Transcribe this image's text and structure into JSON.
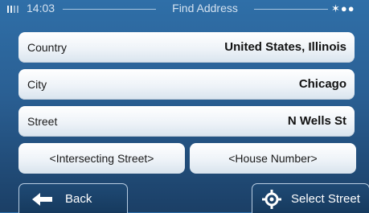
{
  "status_bar": {
    "time": "14:03",
    "title": "Find Address",
    "battery_icon": "battery-bars-icon",
    "satellite_icon": "satellite-dots-icon"
  },
  "rows": [
    {
      "label": "Country",
      "value": "United States, Illinois"
    },
    {
      "label": "City",
      "value": "Chicago"
    },
    {
      "label": "Street",
      "value": "N Wells St"
    }
  ],
  "split_buttons": {
    "intersecting_street": "<Intersecting Street>",
    "house_number": "<House Number>"
  },
  "bottom_bar": {
    "back_label": "Back",
    "back_icon": "arrow-left-icon",
    "select_label": "Select Street",
    "select_icon": "crosshair-target-icon"
  },
  "colors": {
    "background_top": "#2f6fa8",
    "background_bottom": "#1b3f66",
    "row_background": "#ffffff",
    "button_background": "#1f4a75"
  }
}
